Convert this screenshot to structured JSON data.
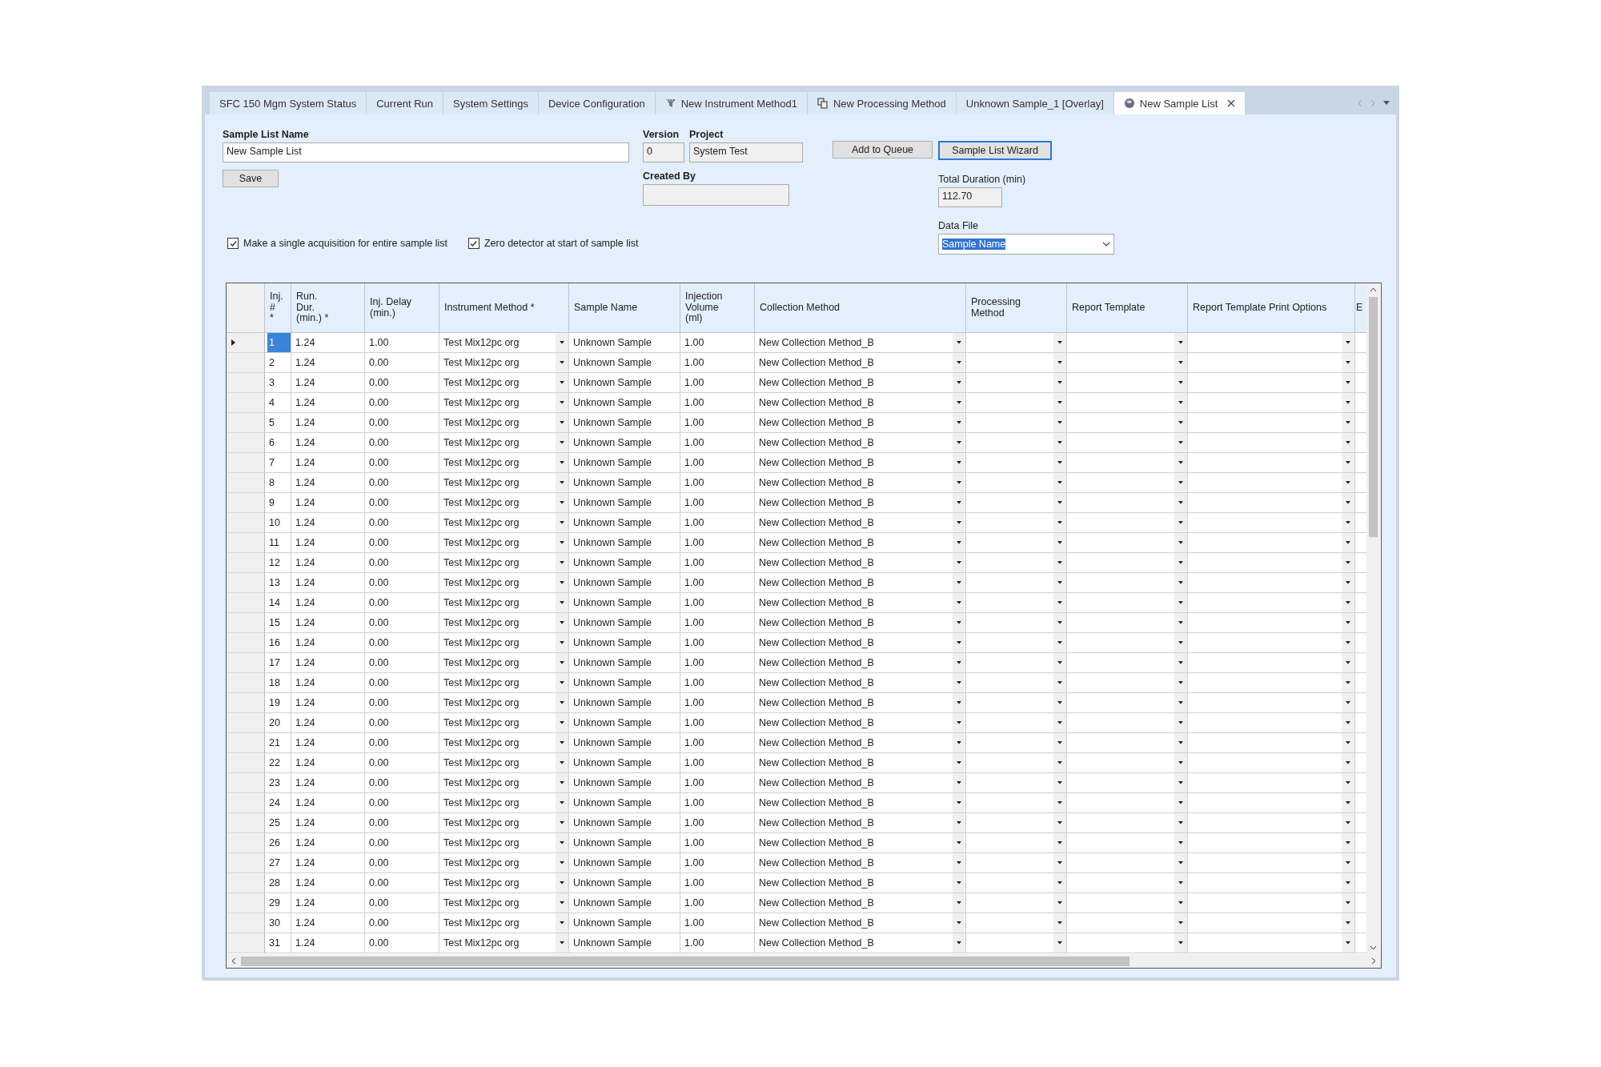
{
  "tabs": [
    {
      "label": "SFC 150 Mgm System Status",
      "kind": "plain",
      "selected": false
    },
    {
      "label": "Current Run",
      "kind": "plain",
      "selected": false
    },
    {
      "label": "System Settings",
      "kind": "plain",
      "selected": false
    },
    {
      "label": "Device Configuration",
      "kind": "plain",
      "selected": false
    },
    {
      "label": "New Instrument Method1",
      "kind": "instrument",
      "selected": false
    },
    {
      "label": "New Processing Method",
      "kind": "processing",
      "selected": false
    },
    {
      "label": "Unknown Sample_1 [Overlay]",
      "kind": "plain",
      "selected": false
    },
    {
      "label": "New Sample List",
      "kind": "samplelist",
      "selected": true
    }
  ],
  "form": {
    "name_label": "Sample List Name",
    "name_value": "New Sample List",
    "save_button": "Save",
    "version_label": "Version",
    "version_value": "0",
    "project_label": "Project",
    "project_value": "System Test",
    "created_by_label": "Created By",
    "add_button": "Add to Queue",
    "wizard_button": "Sample List Wizard",
    "wizard_focused": true,
    "duration_label": "Total Duration (min)",
    "duration_value": "112.70",
    "data_file_label": "Data File",
    "data_file_value": "Sample Name",
    "data_file_highlighted": true
  },
  "options": [
    {
      "label": "Make a single acquisition for entire sample list",
      "checked": true
    },
    {
      "label": "Zero detector at start of sample list",
      "checked": true
    }
  ],
  "table": {
    "columns": [
      {
        "label": "Inj.\n#\n*",
        "kind": "text"
      },
      {
        "label": "Run.\nDur.\n(min.) *",
        "kind": "text"
      },
      {
        "label": "Inj. Delay\n(min.)",
        "kind": "text"
      },
      {
        "label": "Instrument Method  *",
        "kind": "dropdown"
      },
      {
        "label": "Sample Name",
        "kind": "text"
      },
      {
        "label": "Injection\nVolume\n(ml)",
        "kind": "text"
      },
      {
        "label": "Collection Method",
        "kind": "dropdown"
      },
      {
        "label": "Processing\nMethod",
        "kind": "dropdown"
      },
      {
        "label": "Report Template",
        "kind": "dropdown"
      },
      {
        "label": "Report Template Print Options",
        "kind": "dropdown"
      },
      {
        "label": "E",
        "kind": "text"
      }
    ],
    "rows": [
      {
        "selected": true,
        "cells": [
          "1",
          "1.24",
          "1.00",
          "Test Mix12pc org",
          "Unknown Sample",
          "1.00",
          "New Collection Method_B"
        ]
      },
      {
        "selected": false,
        "cells": [
          "2",
          "1.24",
          "0.00",
          "Test Mix12pc org",
          "Unknown Sample",
          "1.00",
          "New Collection Method_B"
        ]
      },
      {
        "selected": false,
        "cells": [
          "3",
          "1.24",
          "0.00",
          "Test Mix12pc org",
          "Unknown Sample",
          "1.00",
          "New Collection Method_B"
        ]
      },
      {
        "selected": false,
        "cells": [
          "4",
          "1.24",
          "0.00",
          "Test Mix12pc org",
          "Unknown Sample",
          "1.00",
          "New Collection Method_B"
        ]
      },
      {
        "selected": false,
        "cells": [
          "5",
          "1.24",
          "0.00",
          "Test Mix12pc org",
          "Unknown Sample",
          "1.00",
          "New Collection Method_B"
        ]
      },
      {
        "selected": false,
        "cells": [
          "6",
          "1.24",
          "0.00",
          "Test Mix12pc org",
          "Unknown Sample",
          "1.00",
          "New Collection Method_B"
        ]
      },
      {
        "selected": false,
        "cells": [
          "7",
          "1.24",
          "0.00",
          "Test Mix12pc org",
          "Unknown Sample",
          "1.00",
          "New Collection Method_B"
        ]
      },
      {
        "selected": false,
        "cells": [
          "8",
          "1.24",
          "0.00",
          "Test Mix12pc org",
          "Unknown Sample",
          "1.00",
          "New Collection Method_B"
        ]
      },
      {
        "selected": false,
        "cells": [
          "9",
          "1.24",
          "0.00",
          "Test Mix12pc org",
          "Unknown Sample",
          "1.00",
          "New Collection Method_B"
        ]
      },
      {
        "selected": false,
        "cells": [
          "10",
          "1.24",
          "0.00",
          "Test Mix12pc org",
          "Unknown Sample",
          "1.00",
          "New Collection Method_B"
        ]
      },
      {
        "selected": false,
        "cells": [
          "11",
          "1.24",
          "0.00",
          "Test Mix12pc org",
          "Unknown Sample",
          "1.00",
          "New Collection Method_B"
        ]
      },
      {
        "selected": false,
        "cells": [
          "12",
          "1.24",
          "0.00",
          "Test Mix12pc org",
          "Unknown Sample",
          "1.00",
          "New Collection Method_B"
        ]
      },
      {
        "selected": false,
        "cells": [
          "13",
          "1.24",
          "0.00",
          "Test Mix12pc org",
          "Unknown Sample",
          "1.00",
          "New Collection Method_B"
        ]
      },
      {
        "selected": false,
        "cells": [
          "14",
          "1.24",
          "0.00",
          "Test Mix12pc org",
          "Unknown Sample",
          "1.00",
          "New Collection Method_B"
        ]
      },
      {
        "selected": false,
        "cells": [
          "15",
          "1.24",
          "0.00",
          "Test Mix12pc org",
          "Unknown Sample",
          "1.00",
          "New Collection Method_B"
        ]
      },
      {
        "selected": false,
        "cells": [
          "16",
          "1.24",
          "0.00",
          "Test Mix12pc org",
          "Unknown Sample",
          "1.00",
          "New Collection Method_B"
        ]
      },
      {
        "selected": false,
        "cells": [
          "17",
          "1.24",
          "0.00",
          "Test Mix12pc org",
          "Unknown Sample",
          "1.00",
          "New Collection Method_B"
        ]
      },
      {
        "selected": false,
        "cells": [
          "18",
          "1.24",
          "0.00",
          "Test Mix12pc org",
          "Unknown Sample",
          "1.00",
          "New Collection Method_B"
        ]
      },
      {
        "selected": false,
        "cells": [
          "19",
          "1.24",
          "0.00",
          "Test Mix12pc org",
          "Unknown Sample",
          "1.00",
          "New Collection Method_B"
        ]
      },
      {
        "selected": false,
        "cells": [
          "20",
          "1.24",
          "0.00",
          "Test Mix12pc org",
          "Unknown Sample",
          "1.00",
          "New Collection Method_B"
        ]
      },
      {
        "selected": false,
        "cells": [
          "21",
          "1.24",
          "0.00",
          "Test Mix12pc org",
          "Unknown Sample",
          "1.00",
          "New Collection Method_B"
        ]
      },
      {
        "selected": false,
        "cells": [
          "22",
          "1.24",
          "0.00",
          "Test Mix12pc org",
          "Unknown Sample",
          "1.00",
          "New Collection Method_B"
        ]
      },
      {
        "selected": false,
        "cells": [
          "23",
          "1.24",
          "0.00",
          "Test Mix12pc org",
          "Unknown Sample",
          "1.00",
          "New Collection Method_B"
        ]
      },
      {
        "selected": false,
        "cells": [
          "24",
          "1.24",
          "0.00",
          "Test Mix12pc org",
          "Unknown Sample",
          "1.00",
          "New Collection Method_B"
        ]
      },
      {
        "selected": false,
        "cells": [
          "25",
          "1.24",
          "0.00",
          "Test Mix12pc org",
          "Unknown Sample",
          "1.00",
          "New Collection Method_B"
        ]
      },
      {
        "selected": false,
        "cells": [
          "26",
          "1.24",
          "0.00",
          "Test Mix12pc org",
          "Unknown Sample",
          "1.00",
          "New Collection Method_B"
        ]
      },
      {
        "selected": false,
        "cells": [
          "27",
          "1.24",
          "0.00",
          "Test Mix12pc org",
          "Unknown Sample",
          "1.00",
          "New Collection Method_B"
        ]
      },
      {
        "selected": false,
        "cells": [
          "28",
          "1.24",
          "0.00",
          "Test Mix12pc org",
          "Unknown Sample",
          "1.00",
          "New Collection Method_B"
        ]
      },
      {
        "selected": false,
        "cells": [
          "29",
          "1.24",
          "0.00",
          "Test Mix12pc org",
          "Unknown Sample",
          "1.00",
          "New Collection Method_B"
        ]
      },
      {
        "selected": false,
        "cells": [
          "30",
          "1.24",
          "0.00",
          "Test Mix12pc org",
          "Unknown Sample",
          "1.00",
          "New Collection Method_B"
        ]
      },
      {
        "selected": false,
        "cells": [
          "31",
          "1.24",
          "0.00",
          "Test Mix12pc org",
          "Unknown Sample",
          "1.00",
          "New Collection Method_B"
        ]
      }
    ]
  }
}
